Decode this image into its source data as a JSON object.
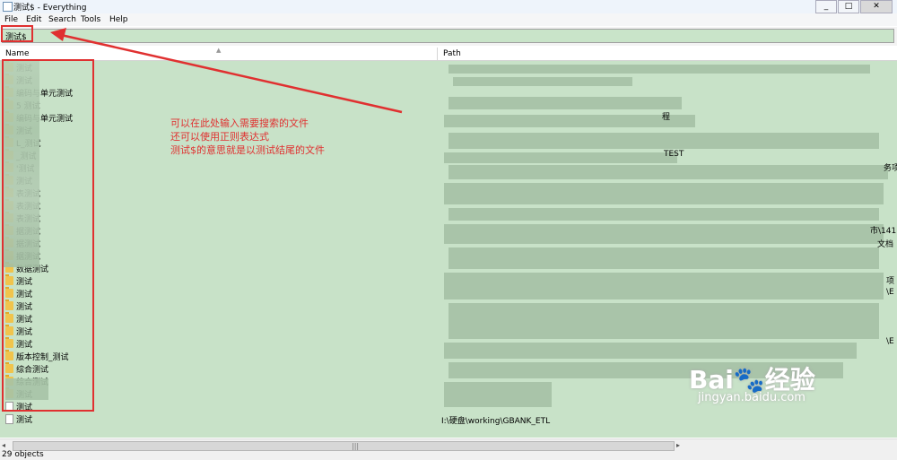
{
  "window": {
    "title": "测试$ - Everything",
    "min": "_",
    "max": "□",
    "close": "✕"
  },
  "menu": [
    "File",
    "Edit",
    "Search",
    "Tools",
    "Help"
  ],
  "search": {
    "value": "测试$"
  },
  "columns": {
    "name": "Name",
    "path": "Path"
  },
  "rows": [
    {
      "name": "测试",
      "icon": "folder-icon"
    },
    {
      "name": "测试",
      "icon": "folder-icon"
    },
    {
      "name": "编码与单元测试",
      "icon": "folder-icon"
    },
    {
      "name": "5 测试",
      "icon": "folder-icon"
    },
    {
      "name": "编码与单元测试",
      "icon": "folder-icon"
    },
    {
      "name": "测试",
      "icon": "folder-icon"
    },
    {
      "name": "L_测试",
      "icon": "folder-icon"
    },
    {
      "name": "_测试",
      "icon": "folder-icon"
    },
    {
      "name": "'测试",
      "icon": "folder-icon"
    },
    {
      "name": "测试",
      "icon": "folder-icon"
    },
    {
      "name": "表测试",
      "icon": "folder-icon"
    },
    {
      "name": "表测试",
      "icon": "folder-icon"
    },
    {
      "name": "表测试",
      "icon": "folder-icon"
    },
    {
      "name": "据测试",
      "icon": "folder-icon"
    },
    {
      "name": "据测试",
      "icon": "folder-icon"
    },
    {
      "name": "据测试",
      "icon": "folder-icon"
    },
    {
      "name": "数据测试",
      "icon": "folder-icon"
    },
    {
      "name": "测试",
      "icon": "folder-icon"
    },
    {
      "name": "测试",
      "icon": "folder-icon"
    },
    {
      "name": "测试",
      "icon": "folder-icon"
    },
    {
      "name": "测试",
      "icon": "folder-icon"
    },
    {
      "name": "测试",
      "icon": "folder-icon"
    },
    {
      "name": "测试",
      "icon": "folder-icon"
    },
    {
      "name": "版本控制_测试",
      "icon": "folder-icon"
    },
    {
      "name": "综合测试",
      "icon": "folder-icon"
    },
    {
      "name": "综合测试",
      "icon": "folder-icon"
    },
    {
      "name": "测试",
      "icon": "folder-icon"
    },
    {
      "name": "测试",
      "icon": "file-icon"
    },
    {
      "name": "测试",
      "icon": "file-icon"
    }
  ],
  "paths": {
    "last": "I:\\硬盘\\working\\GBANK_ETL",
    "fragments": [
      "程",
      "TEST",
      "务项",
      "市\\141",
      "文档",
      "项",
      "\\E",
      "\\E"
    ]
  },
  "annotation": [
    "可以在此处输入需要搜索的文件",
    "还可以使用正则表达式",
    "测试$的意思就是以测试结尾的文件"
  ],
  "status": "29 objects",
  "watermark": {
    "brand": "Bai🐾经验",
    "url": "jingyan.baidu.com"
  },
  "colors": {
    "accent": "#e03030",
    "results_bg": "#c8e2c8"
  }
}
